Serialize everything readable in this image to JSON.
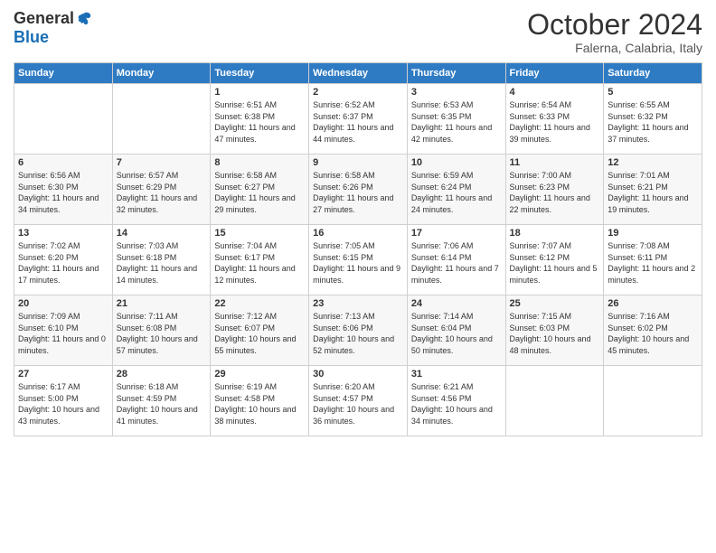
{
  "header": {
    "logo_general": "General",
    "logo_blue": "Blue",
    "month_title": "October 2024",
    "location": "Falerna, Calabria, Italy"
  },
  "weekdays": [
    "Sunday",
    "Monday",
    "Tuesday",
    "Wednesday",
    "Thursday",
    "Friday",
    "Saturday"
  ],
  "weeks": [
    [
      {
        "day": "",
        "info": ""
      },
      {
        "day": "",
        "info": ""
      },
      {
        "day": "1",
        "info": "Sunrise: 6:51 AM\nSunset: 6:38 PM\nDaylight: 11 hours and 47 minutes."
      },
      {
        "day": "2",
        "info": "Sunrise: 6:52 AM\nSunset: 6:37 PM\nDaylight: 11 hours and 44 minutes."
      },
      {
        "day": "3",
        "info": "Sunrise: 6:53 AM\nSunset: 6:35 PM\nDaylight: 11 hours and 42 minutes."
      },
      {
        "day": "4",
        "info": "Sunrise: 6:54 AM\nSunset: 6:33 PM\nDaylight: 11 hours and 39 minutes."
      },
      {
        "day": "5",
        "info": "Sunrise: 6:55 AM\nSunset: 6:32 PM\nDaylight: 11 hours and 37 minutes."
      }
    ],
    [
      {
        "day": "6",
        "info": "Sunrise: 6:56 AM\nSunset: 6:30 PM\nDaylight: 11 hours and 34 minutes."
      },
      {
        "day": "7",
        "info": "Sunrise: 6:57 AM\nSunset: 6:29 PM\nDaylight: 11 hours and 32 minutes."
      },
      {
        "day": "8",
        "info": "Sunrise: 6:58 AM\nSunset: 6:27 PM\nDaylight: 11 hours and 29 minutes."
      },
      {
        "day": "9",
        "info": "Sunrise: 6:58 AM\nSunset: 6:26 PM\nDaylight: 11 hours and 27 minutes."
      },
      {
        "day": "10",
        "info": "Sunrise: 6:59 AM\nSunset: 6:24 PM\nDaylight: 11 hours and 24 minutes."
      },
      {
        "day": "11",
        "info": "Sunrise: 7:00 AM\nSunset: 6:23 PM\nDaylight: 11 hours and 22 minutes."
      },
      {
        "day": "12",
        "info": "Sunrise: 7:01 AM\nSunset: 6:21 PM\nDaylight: 11 hours and 19 minutes."
      }
    ],
    [
      {
        "day": "13",
        "info": "Sunrise: 7:02 AM\nSunset: 6:20 PM\nDaylight: 11 hours and 17 minutes."
      },
      {
        "day": "14",
        "info": "Sunrise: 7:03 AM\nSunset: 6:18 PM\nDaylight: 11 hours and 14 minutes."
      },
      {
        "day": "15",
        "info": "Sunrise: 7:04 AM\nSunset: 6:17 PM\nDaylight: 11 hours and 12 minutes."
      },
      {
        "day": "16",
        "info": "Sunrise: 7:05 AM\nSunset: 6:15 PM\nDaylight: 11 hours and 9 minutes."
      },
      {
        "day": "17",
        "info": "Sunrise: 7:06 AM\nSunset: 6:14 PM\nDaylight: 11 hours and 7 minutes."
      },
      {
        "day": "18",
        "info": "Sunrise: 7:07 AM\nSunset: 6:12 PM\nDaylight: 11 hours and 5 minutes."
      },
      {
        "day": "19",
        "info": "Sunrise: 7:08 AM\nSunset: 6:11 PM\nDaylight: 11 hours and 2 minutes."
      }
    ],
    [
      {
        "day": "20",
        "info": "Sunrise: 7:09 AM\nSunset: 6:10 PM\nDaylight: 11 hours and 0 minutes."
      },
      {
        "day": "21",
        "info": "Sunrise: 7:11 AM\nSunset: 6:08 PM\nDaylight: 10 hours and 57 minutes."
      },
      {
        "day": "22",
        "info": "Sunrise: 7:12 AM\nSunset: 6:07 PM\nDaylight: 10 hours and 55 minutes."
      },
      {
        "day": "23",
        "info": "Sunrise: 7:13 AM\nSunset: 6:06 PM\nDaylight: 10 hours and 52 minutes."
      },
      {
        "day": "24",
        "info": "Sunrise: 7:14 AM\nSunset: 6:04 PM\nDaylight: 10 hours and 50 minutes."
      },
      {
        "day": "25",
        "info": "Sunrise: 7:15 AM\nSunset: 6:03 PM\nDaylight: 10 hours and 48 minutes."
      },
      {
        "day": "26",
        "info": "Sunrise: 7:16 AM\nSunset: 6:02 PM\nDaylight: 10 hours and 45 minutes."
      }
    ],
    [
      {
        "day": "27",
        "info": "Sunrise: 6:17 AM\nSunset: 5:00 PM\nDaylight: 10 hours and 43 minutes."
      },
      {
        "day": "28",
        "info": "Sunrise: 6:18 AM\nSunset: 4:59 PM\nDaylight: 10 hours and 41 minutes."
      },
      {
        "day": "29",
        "info": "Sunrise: 6:19 AM\nSunset: 4:58 PM\nDaylight: 10 hours and 38 minutes."
      },
      {
        "day": "30",
        "info": "Sunrise: 6:20 AM\nSunset: 4:57 PM\nDaylight: 10 hours and 36 minutes."
      },
      {
        "day": "31",
        "info": "Sunrise: 6:21 AM\nSunset: 4:56 PM\nDaylight: 10 hours and 34 minutes."
      },
      {
        "day": "",
        "info": ""
      },
      {
        "day": "",
        "info": ""
      }
    ]
  ]
}
